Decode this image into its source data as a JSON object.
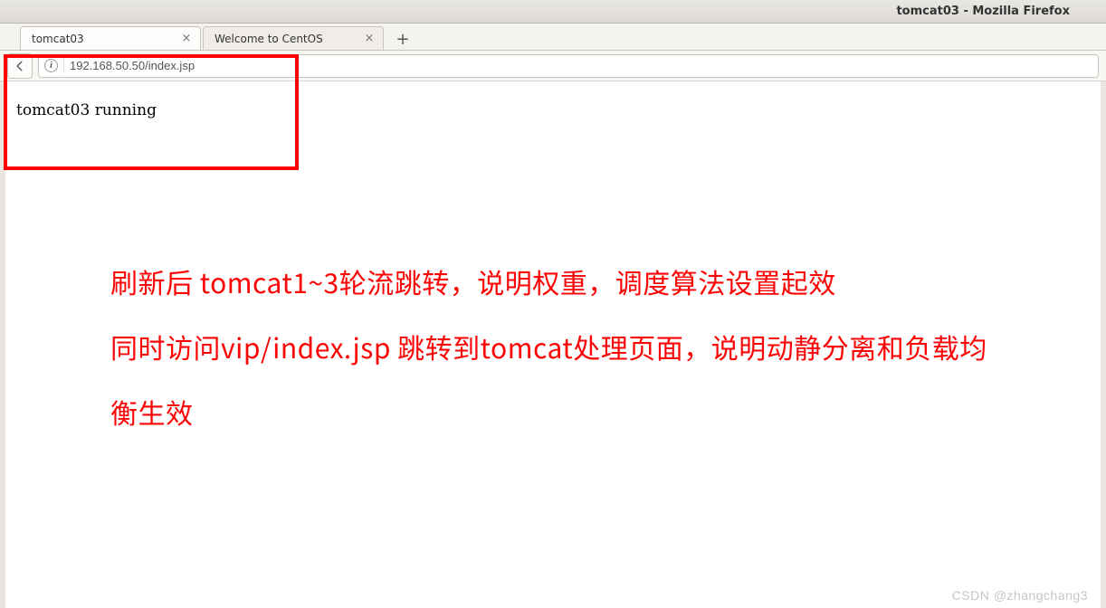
{
  "window": {
    "title": "tomcat03 - Mozilla Firefox"
  },
  "tabs": [
    {
      "label": "tomcat03",
      "active": true
    },
    {
      "label": "Welcome to CentOS",
      "active": false
    }
  ],
  "url": "192.168.50.50/index.jsp",
  "page": {
    "body_text": "tomcat03 running"
  },
  "annotation": {
    "line1": "刷新后 tomcat1~3轮流跳转，说明权重，调度算法设置起效",
    "line2": "同时访问vip/index.jsp 跳转到tomcat处理页面，说明动静分离和负载均衡生效"
  },
  "watermark": "CSDN @zhangchang3",
  "icons": {
    "close": "×",
    "new_tab": "+"
  }
}
